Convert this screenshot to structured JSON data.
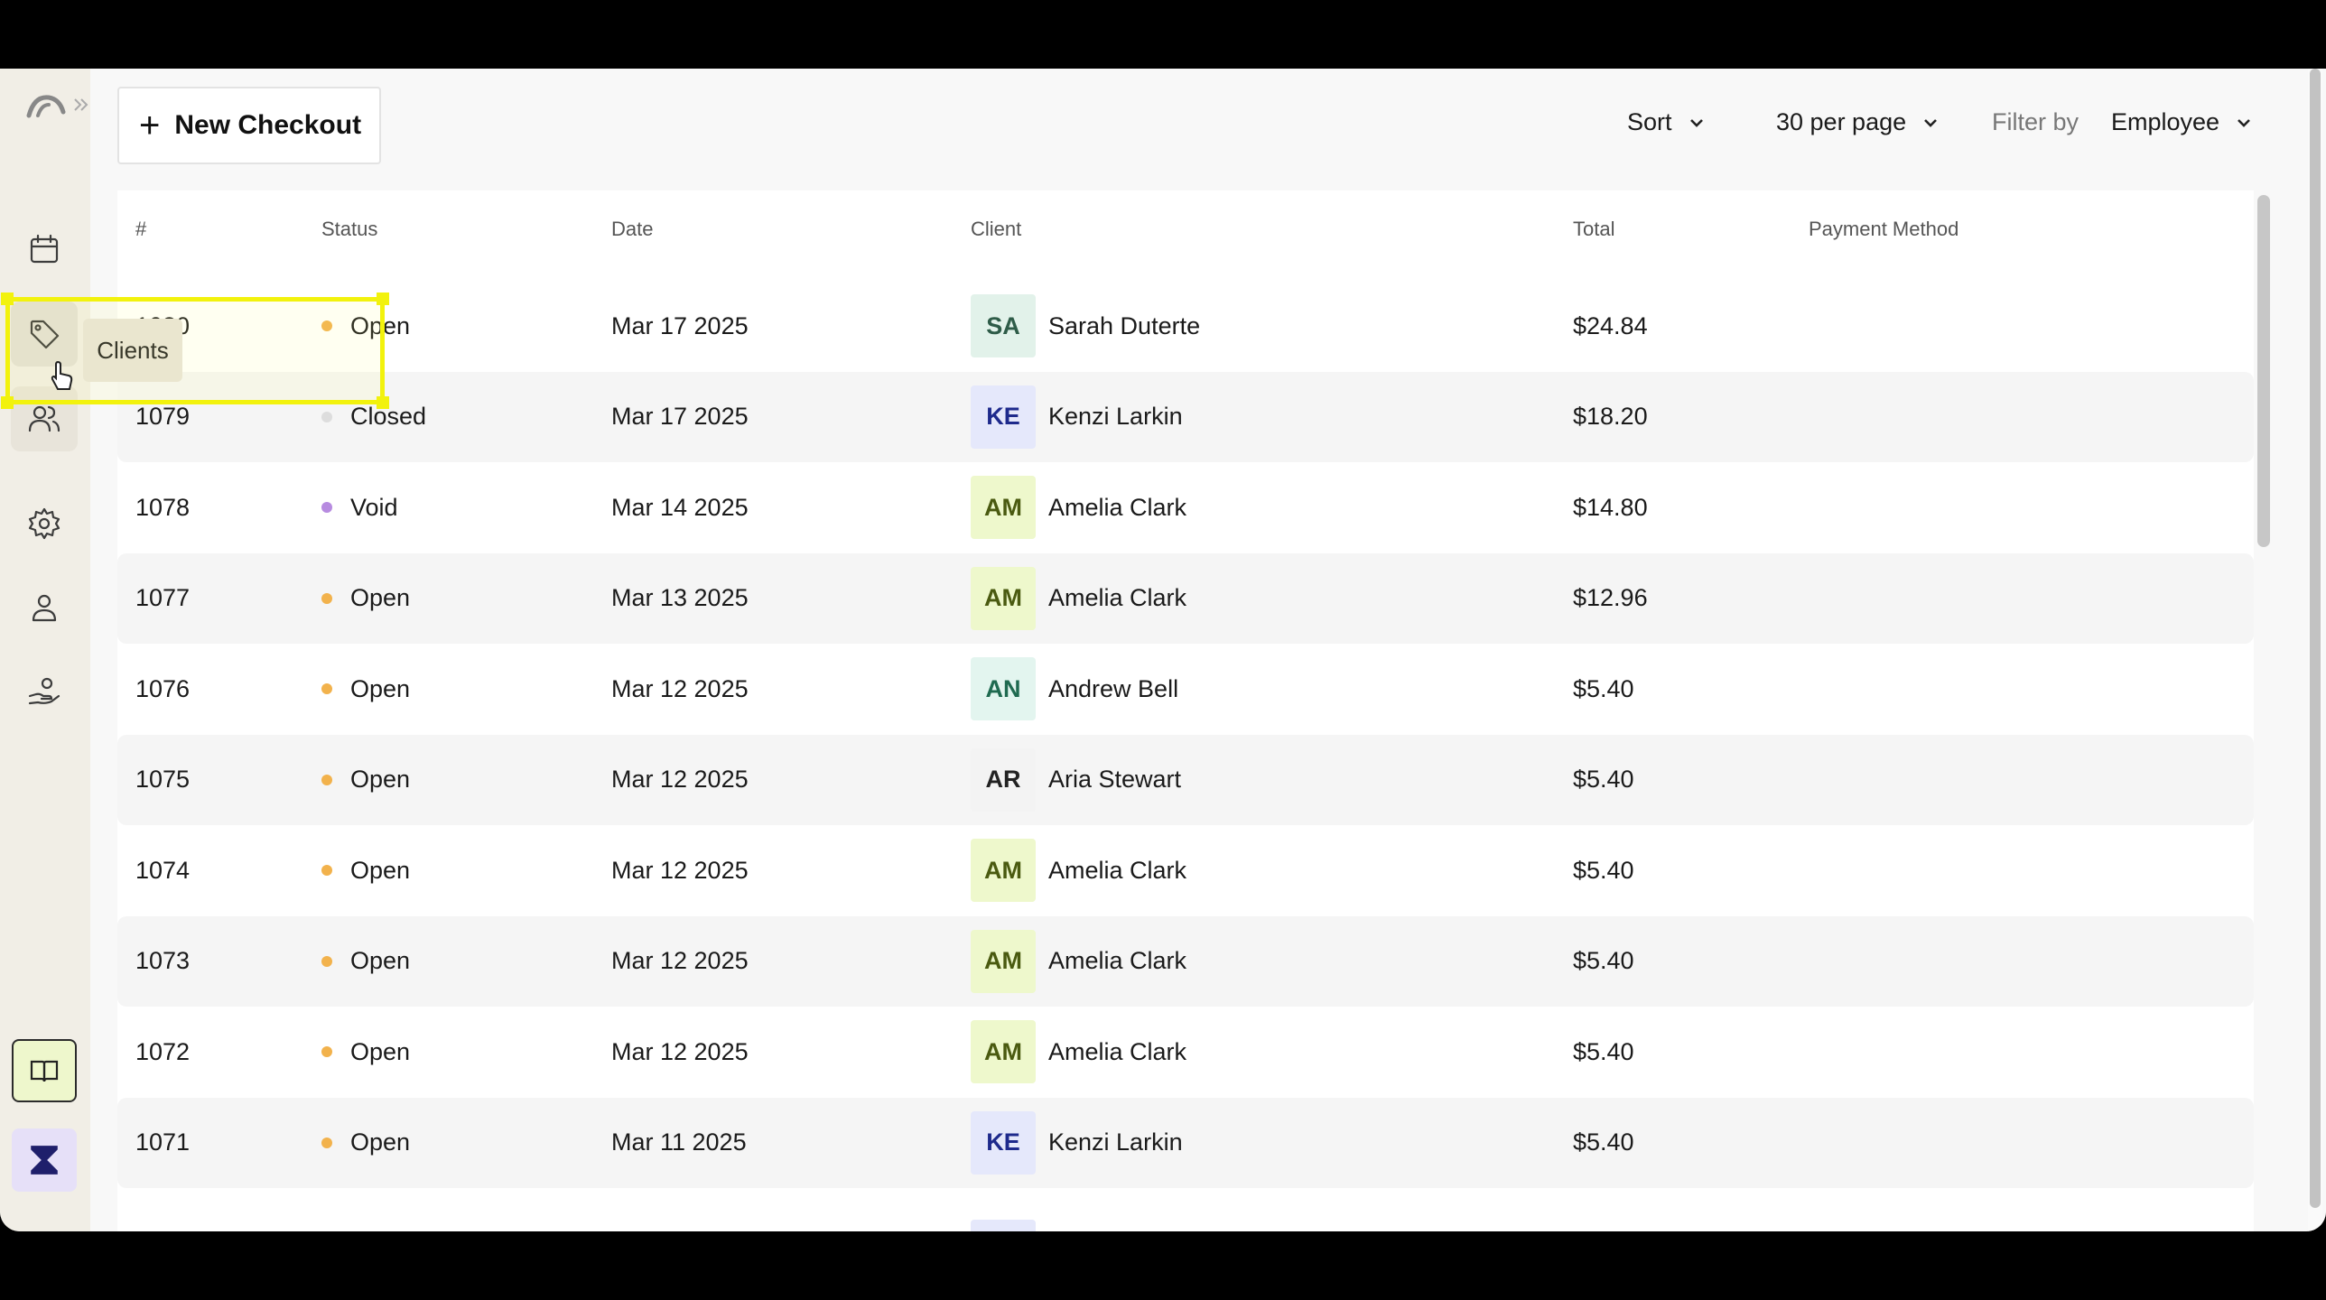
{
  "sidebar": {
    "tooltip": "Clients",
    "items": [
      {
        "name": "calendar"
      },
      {
        "name": "tag"
      },
      {
        "name": "clients"
      },
      {
        "name": "settings"
      },
      {
        "name": "user"
      },
      {
        "name": "services"
      }
    ]
  },
  "toolbar": {
    "new_checkout_label": "New Checkout",
    "sort_label": "Sort",
    "per_page_label": "30 per page",
    "filter_label": "Filter by",
    "filter_value": "Employee"
  },
  "table": {
    "headers": {
      "number": "#",
      "status": "Status",
      "date": "Date",
      "client": "Client",
      "total": "Total",
      "payment_method": "Payment Method"
    },
    "rows": [
      {
        "number": "1080",
        "status": "Open",
        "date": "Mar 17 2025",
        "initials": "SA",
        "client": "Sarah Duterte",
        "total": "$24.84"
      },
      {
        "number": "1079",
        "status": "Closed",
        "date": "Mar 17 2025",
        "initials": "KE",
        "client": "Kenzi Larkin",
        "total": "$18.20"
      },
      {
        "number": "1078",
        "status": "Void",
        "date": "Mar 14 2025",
        "initials": "AM",
        "client": "Amelia Clark",
        "total": "$14.80"
      },
      {
        "number": "1077",
        "status": "Open",
        "date": "Mar 13 2025",
        "initials": "AM",
        "client": "Amelia Clark",
        "total": "$12.96"
      },
      {
        "number": "1076",
        "status": "Open",
        "date": "Mar 12 2025",
        "initials": "AN",
        "client": "Andrew Bell",
        "total": "$5.40"
      },
      {
        "number": "1075",
        "status": "Open",
        "date": "Mar 12 2025",
        "initials": "AR",
        "client": "Aria Stewart",
        "total": "$5.40"
      },
      {
        "number": "1074",
        "status": "Open",
        "date": "Mar 12 2025",
        "initials": "AM",
        "client": "Amelia Clark",
        "total": "$5.40"
      },
      {
        "number": "1073",
        "status": "Open",
        "date": "Mar 12 2025",
        "initials": "AM",
        "client": "Amelia Clark",
        "total": "$5.40"
      },
      {
        "number": "1072",
        "status": "Open",
        "date": "Mar 12 2025",
        "initials": "AM",
        "client": "Amelia Clark",
        "total": "$5.40"
      },
      {
        "number": "1071",
        "status": "Open",
        "date": "Mar 11 2025",
        "initials": "KE",
        "client": "Kenzi Larkin",
        "total": "$5.40"
      }
    ]
  },
  "colors": {
    "status_open": "#f2b24c",
    "status_closed": "#dddddd",
    "status_void": "#b78be0",
    "avatar_SA": {
      "bg": "#e2f2ea",
      "fg": "#2e5c48"
    },
    "avatar_KE": {
      "bg": "#e5e8fb",
      "fg": "#1e2a8c"
    },
    "avatar_AM": {
      "bg": "#eef8cc",
      "fg": "#4a5a10"
    },
    "avatar_AN": {
      "bg": "#e3f5ef",
      "fg": "#1f6a50"
    },
    "avatar_AR": {
      "bg": "#f3f3f3",
      "fg": "#222222"
    },
    "brand": "#1f1f6b"
  }
}
